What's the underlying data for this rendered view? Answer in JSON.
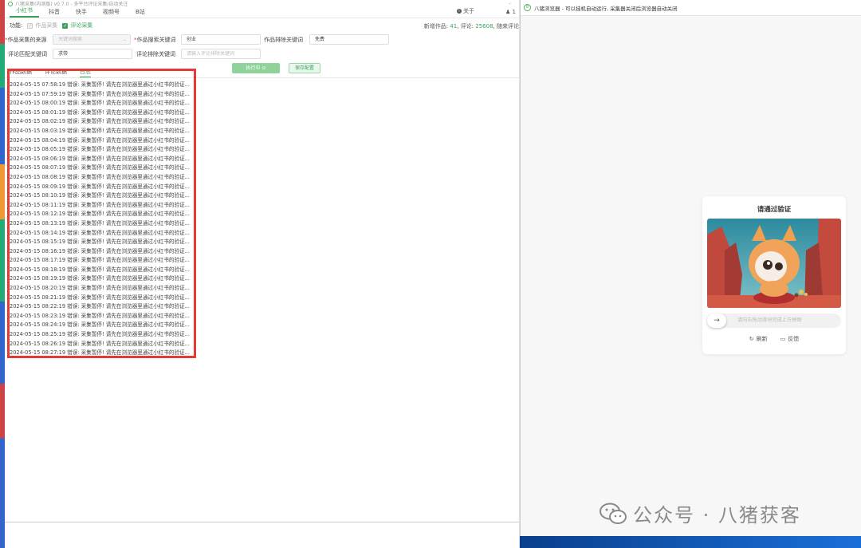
{
  "app": {
    "title": "八猪采集(内测版) v0.7.0 - 多平台评论采集/自动关注",
    "tabs": [
      {
        "label": "小红书",
        "active": true
      },
      {
        "label": "抖音",
        "active": false
      },
      {
        "label": "快手",
        "active": false
      },
      {
        "label": "视频号",
        "active": false
      },
      {
        "label": "B站",
        "active": false
      }
    ],
    "about_label": "关于",
    "user_label": "1"
  },
  "functions": {
    "label": "功能:",
    "options": [
      {
        "label": "作品采集",
        "checked": true,
        "disabled": true
      },
      {
        "label": "评论采集",
        "checked": true,
        "disabled": false
      }
    ],
    "stats": {
      "works_label": "新增作品:",
      "works_value": "41",
      "comments_label": "评论:",
      "comments_value": "25608",
      "extra_label": "随来评论"
    }
  },
  "form": {
    "source_label": "作品采集的来源",
    "source_value": "关键词搜索",
    "search_kw_label": "作品搜索关键词",
    "search_kw_value": "创业",
    "exclude_kw_label": "作品排除关键词",
    "exclude_kw_value": "免费",
    "comment_match_label": "评论匹配关键词",
    "comment_match_value": "求带",
    "comment_exclude_label": "评论排除关键词",
    "comment_exclude_placeholder": "请输入评论排除关键词"
  },
  "actions": {
    "run_label": "执行中 ⊙",
    "save_label": "保存配置"
  },
  "log_tabs": [
    {
      "label": "作品数据",
      "active": false
    },
    {
      "label": "评论数据",
      "active": false
    },
    {
      "label": "日志",
      "active": true
    }
  ],
  "log_lines": [
    "2024-05-15 07:58:19 错误: 采集暂停! 请先在浏览器里通过小红书的验证...",
    "2024-05-15 07:59:19 错误: 采集暂停! 请先在浏览器里通过小红书的验证...",
    "2024-05-15 08:00:19 错误: 采集暂停! 请先在浏览器里通过小红书的验证...",
    "2024-05-15 08:01:19 错误: 采集暂停! 请先在浏览器里通过小红书的验证...",
    "2024-05-15 08:02:19 错误: 采集暂停! 请先在浏览器里通过小红书的验证...",
    "2024-05-15 08:03:19 错误: 采集暂停! 请先在浏览器里通过小红书的验证...",
    "2024-05-15 08:04:19 错误: 采集暂停! 请先在浏览器里通过小红书的验证...",
    "2024-05-15 08:05:19 错误: 采集暂停! 请先在浏览器里通过小红书的验证...",
    "2024-05-15 08:06:19 错误: 采集暂停! 请先在浏览器里通过小红书的验证...",
    "2024-05-15 08:07:19 错误: 采集暂停! 请先在浏览器里通过小红书的验证...",
    "2024-05-15 08:08:19 错误: 采集暂停! 请先在浏览器里通过小红书的验证...",
    "2024-05-15 08:09:19 错误: 采集暂停! 请先在浏览器里通过小红书的验证...",
    "2024-05-15 08:10:19 错误: 采集暂停! 请先在浏览器里通过小红书的验证...",
    "2024-05-15 08:11:19 错误: 采集暂停! 请先在浏览器里通过小红书的验证...",
    "2024-05-15 08:12:19 错误: 采集暂停! 请先在浏览器里通过小红书的验证...",
    "2024-05-15 08:13:19 错误: 采集暂停! 请先在浏览器里通过小红书的验证...",
    "2024-05-15 08:14:19 错误: 采集暂停! 请先在浏览器里通过小红书的验证...",
    "2024-05-15 08:15:19 错误: 采集暂停! 请先在浏览器里通过小红书的验证...",
    "2024-05-15 08:16:19 错误: 采集暂停! 请先在浏览器里通过小红书的验证...",
    "2024-05-15 08:17:19 错误: 采集暂停! 请先在浏览器里通过小红书的验证...",
    "2024-05-15 08:18:19 错误: 采集暂停! 请先在浏览器里通过小红书的验证...",
    "2024-05-15 08:19:19 错误: 采集暂停! 请先在浏览器里通过小红书的验证...",
    "2024-05-15 08:20:19 错误: 采集暂停! 请先在浏览器里通过小红书的验证...",
    "2024-05-15 08:21:19 错误: 采集暂停! 请先在浏览器里通过小红书的验证...",
    "2024-05-15 08:22:19 错误: 采集暂停! 请先在浏览器里通过小红书的验证...",
    "2024-05-15 08:23:19 错误: 采集暂停! 请先在浏览器里通过小红书的验证...",
    "2024-05-15 08:24:19 错误: 采集暂停! 请先在浏览器里通过小红书的验证...",
    "2024-05-15 08:25:19 错误: 采集暂停! 请先在浏览器里通过小红书的验证...",
    "2024-05-15 08:26:19 错误: 采集暂停! 请先在浏览器里通过小红书的验证...",
    "2024-05-15 08:27:19 错误: 采集暂停! 请先在浏览器里通过小红书的验证..."
  ],
  "browser": {
    "title": "八猪浏览器 - 可以挂机自动运行, 采集器关闭后浏览器自动关闭",
    "captcha": {
      "title": "请通过验证",
      "slider_hint": "请向右拖动滑块完成上方拼图",
      "refresh_label": "刷新",
      "feedback_label": "反馈"
    }
  },
  "watermark": {
    "text": "公众号 · 八猪获客",
    "icon": "wechat-icon"
  },
  "colors": {
    "accent": "#3aa35a",
    "highlight": "#e53935"
  }
}
